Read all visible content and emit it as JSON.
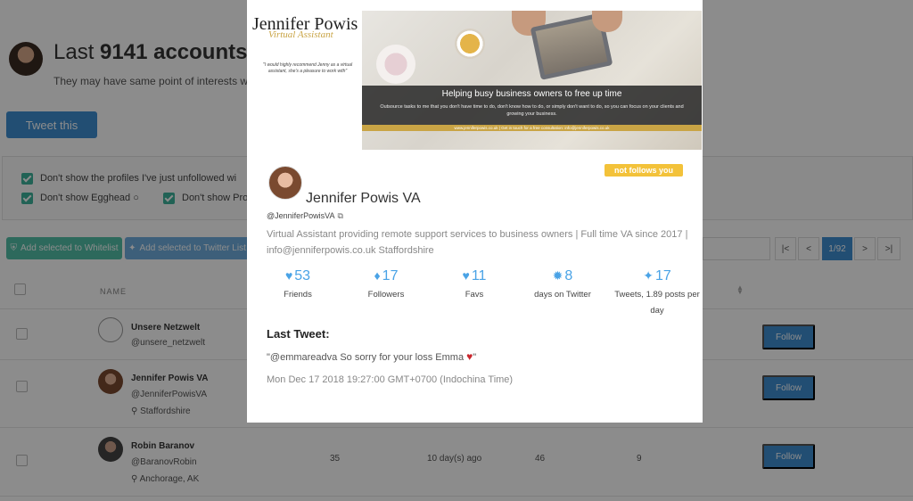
{
  "page": {
    "title_prefix": "Last ",
    "title_count": "9141 accounts",
    "subtitle": "They may have same point of interests with y",
    "tweet_button": "Tweet this",
    "filters": [
      "Don't show the profiles I've just unfollowed wi",
      "Don't show Egghead",
      "Don't show Pro"
    ],
    "actions": {
      "whitelist": "Add selected to Whitelist",
      "twitter_list": "Add selected to Twitter List"
    },
    "pagination": {
      "first": "|<",
      "prev": "<",
      "current": "1/92",
      "next": ">",
      "last": ">|"
    },
    "table": {
      "name_header": "NAME",
      "rows": [
        {
          "name": "Unsere Netzwelt",
          "handle": "@unsere_netzwelt",
          "location": "",
          "follow": "Follow"
        },
        {
          "name": "Jennifer Powis VA",
          "handle": "@JenniferPowisVA",
          "location": "Staffordshire",
          "follow": "Follow"
        },
        {
          "name": "Robin Baranov",
          "handle": "@BaranovRobin",
          "location": "Anchorage, AK",
          "c1": "35",
          "c2": "10 day(s) ago",
          "c3": "46",
          "c4": "9",
          "follow": "Follow"
        }
      ]
    }
  },
  "modal": {
    "banner": {
      "brand_name": "Jennifer Powis",
      "brand_tagline": "Virtual Assistant",
      "quote": "\"I would highly recommend Jenny as a virtual assistant, she's a pleasure to work with\"",
      "headline": "Helping busy business owners to free up time",
      "text": "Outsource tasks to me that you don't have time to do, don't know how to do, or simply don't want to do, so you can focus on your clients and growing your business.",
      "footer": "www.jenniferpowis.co.uk | Get in touch for a free consultation: info@jenniferpowis.co.uk"
    },
    "badge": "not follows you",
    "name": "Jennifer Powis VA",
    "handle": "@JenniferPowisVA",
    "bio": "Virtual Assistant providing remote support services to business owners | Full time VA since 2017 | info@jenniferpowis.co.uk Staffordshire",
    "stats": [
      {
        "icon": "heart-icon",
        "value": "53",
        "label": "Friends"
      },
      {
        "icon": "drop-icon",
        "value": "17",
        "label": "Followers"
      },
      {
        "icon": "heart-icon",
        "value": "11",
        "label": "Favs"
      },
      {
        "icon": "badge-icon",
        "value": "8",
        "label": "days on Twitter"
      },
      {
        "icon": "twitter-icon",
        "value": "17",
        "label": "Tweets, 1.89 posts per day"
      }
    ],
    "last_tweet_title": "Last Tweet:",
    "last_tweet_text": "\"@emmareadva So sorry for your loss Emma ",
    "last_tweet_close": "\"",
    "last_tweet_date": "Mon Dec 17 2018 19:27:00 GMT+0700 (Indochina Time)"
  },
  "colors": {
    "accent": "#3f8fd2",
    "green": "#52bfa8",
    "badge": "#f3c23a",
    "stat": "#4aa3e6",
    "gold": "#c9a445"
  }
}
